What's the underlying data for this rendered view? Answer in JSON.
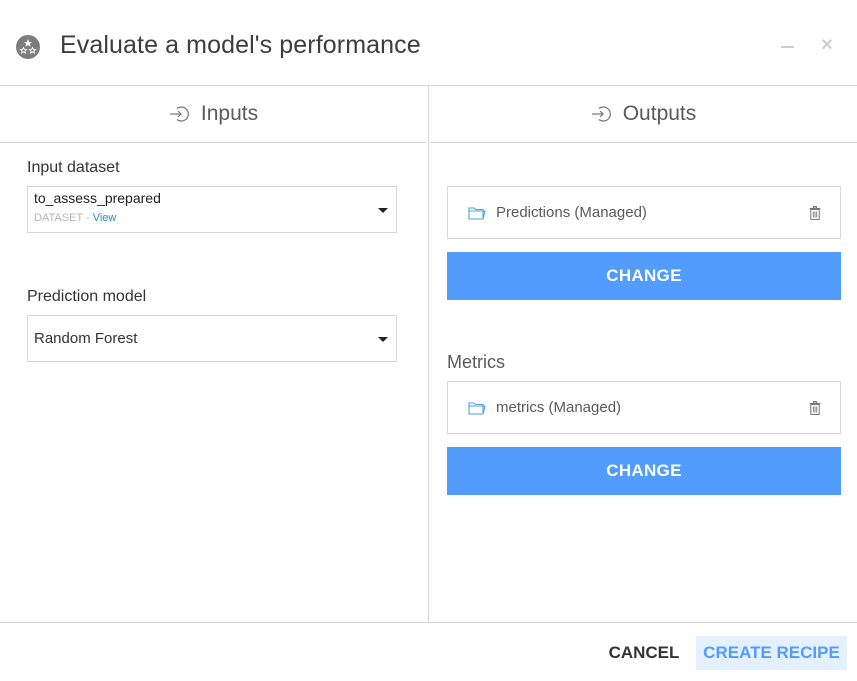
{
  "dialog": {
    "title": "Evaluate a model's performance",
    "icon": "evaluate-recipe-icon",
    "minimize_icon": "minimize-icon",
    "close_icon": "close-icon",
    "close_glyph": "×"
  },
  "inputs": {
    "header": "Inputs",
    "icon": "input-arrow-icon",
    "input_dataset": {
      "label": "Input dataset",
      "value": "to_assess_prepared",
      "type_label": "DATASET",
      "separator": " - ",
      "view_link": "View"
    },
    "prediction_model": {
      "label": "Prediction model",
      "value": "Random Forest"
    }
  },
  "outputs": {
    "header": "Outputs",
    "icon": "output-arrow-icon",
    "predictions": {
      "name": "Predictions (Managed)",
      "icon": "folder-icon",
      "delete_icon": "trash-icon",
      "change_label": "CHANGE"
    },
    "metrics": {
      "section_label": "Metrics",
      "name": "metrics (Managed)",
      "icon": "folder-icon",
      "delete_icon": "trash-icon",
      "change_label": "CHANGE"
    }
  },
  "footer": {
    "cancel_label": "CANCEL",
    "create_label": "CREATE RECIPE"
  },
  "colors": {
    "primary": "#519cfc",
    "primary_light": "#e4f0fe",
    "link": "#2a8ad6",
    "folder": "#4ba3d9",
    "border": "#d9d9d9"
  }
}
